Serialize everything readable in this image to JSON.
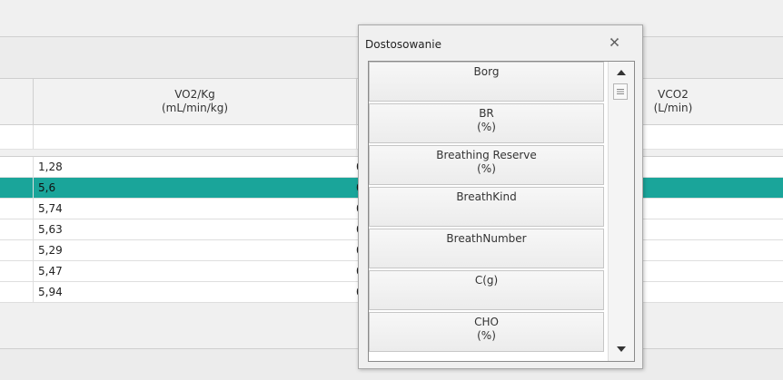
{
  "grid": {
    "columns": [
      {
        "name": "VO2/Kg",
        "unit": "(mL/min/kg)"
      },
      {
        "name": "VCO2",
        "unit": "(L/min)"
      }
    ],
    "rows": [
      {
        "col1": "1,28",
        "col2": "0",
        "selected": false
      },
      {
        "col1": "5,6",
        "col2": "0",
        "selected": true
      },
      {
        "col1": "5,74",
        "col2": "0",
        "selected": false
      },
      {
        "col1": "5,63",
        "col2": "0",
        "selected": false
      },
      {
        "col1": "5,29",
        "col2": "0",
        "selected": false
      },
      {
        "col1": "5,47",
        "col2": "0",
        "selected": false
      },
      {
        "col1": "5,94",
        "col2": "0",
        "selected": false
      }
    ],
    "selection_color": "#1aa59a"
  },
  "popup": {
    "title": "Dostosowanie",
    "close_icon": "close-icon",
    "items": [
      {
        "label": "Borg",
        "unit": ""
      },
      {
        "label": "BR",
        "unit": "(%)"
      },
      {
        "label": "Breathing Reserve",
        "unit": "(%)"
      },
      {
        "label": "BreathKind",
        "unit": ""
      },
      {
        "label": "BreathNumber",
        "unit": ""
      },
      {
        "label": "C(g)",
        "unit": ""
      },
      {
        "label": "CHO",
        "unit": "(%)"
      }
    ]
  }
}
